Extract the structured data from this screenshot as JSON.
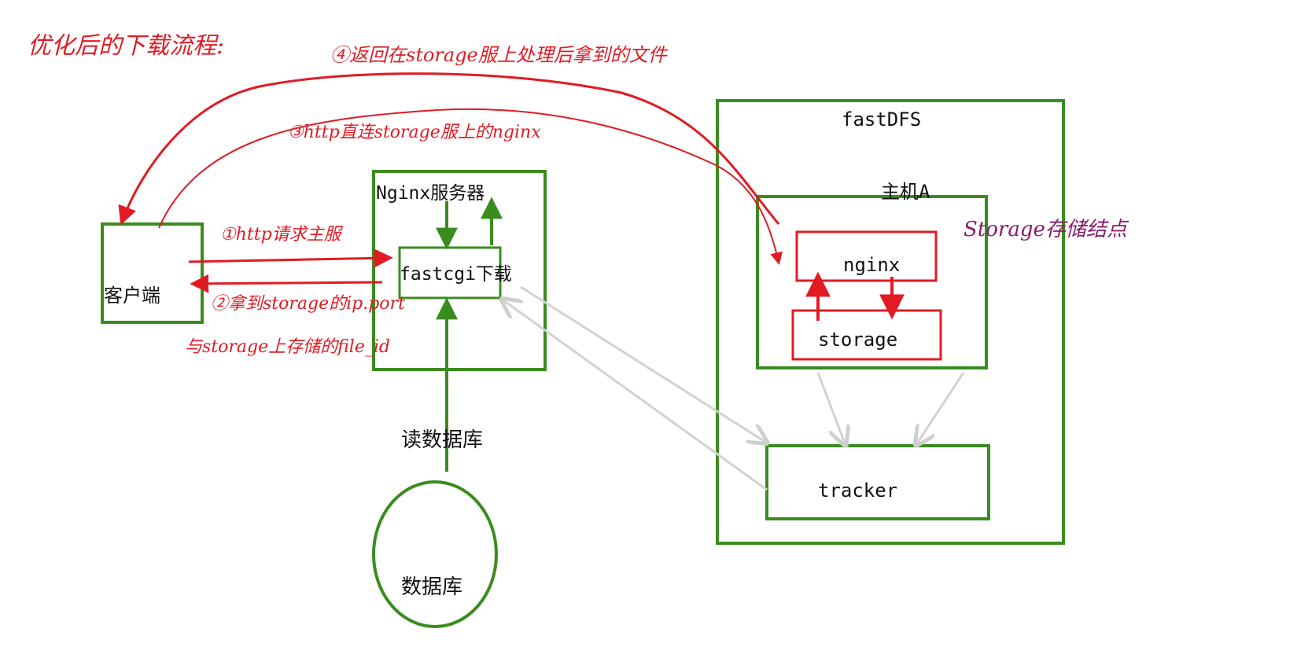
{
  "title": "优化后的下载流程:",
  "colors": {
    "green": "#3a8c1e",
    "red": "#e01b24",
    "gray": "#d2d2d2",
    "purple": "#8a1a6a"
  },
  "nodes": {
    "client": "客户端",
    "nginx_server": "Nginx服务器",
    "fastcgi": "fastcgi下载",
    "read_db": "读数据库",
    "database": "数据库",
    "fastdfs": "fastDFS",
    "host_a": "主机A",
    "storage_nginx": "nginx",
    "storage": "storage",
    "tracker": "tracker"
  },
  "annotations": {
    "step1": "①http请求主服",
    "step2_line1": "②拿到storage的ip.port",
    "step2_line2": "与storage上存储的file_id",
    "step3": "③http直连storage服上的nginx",
    "step4": "④返回在storage服上处理后拿到的文件",
    "storage_node": "Storage存储结点"
  }
}
